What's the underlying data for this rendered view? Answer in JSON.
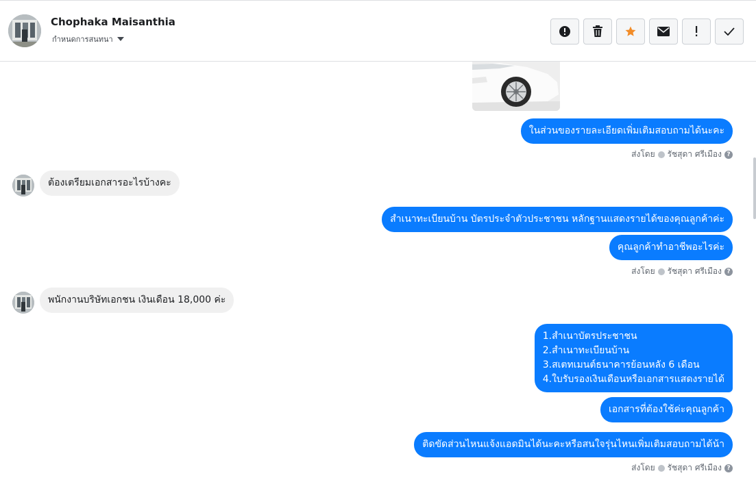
{
  "header": {
    "contact_name": "Chophaka Maisanthia",
    "subtitle": "กำหนดการสนทนา",
    "tools": [
      {
        "name": "report-spam-button",
        "icon": "alert-circle-icon"
      },
      {
        "name": "delete-button",
        "icon": "trash-icon"
      },
      {
        "name": "star-button",
        "icon": "star-icon"
      },
      {
        "name": "mark-unread-button",
        "icon": "envelope-icon"
      },
      {
        "name": "follow-up-button",
        "icon": "exclamation-icon"
      },
      {
        "name": "mark-done-button",
        "icon": "check-icon"
      }
    ],
    "star_color": "#f28c28"
  },
  "colors": {
    "outgoing": "#0a7cff",
    "incoming": "#f0f0f0"
  },
  "messages": {
    "m1": "ในส่วนของรายละเอียดเพิ่มเติมสอบถามได้นะคะ",
    "m2": "ต้องเตรียมเอกสารอะไรบ้างคะ",
    "m3": "สำเนาทะเบียนบ้าน บัตรประจำตัวประชาชน หลักฐานแสดงรายได้ของคุณลูกค้าค่ะ",
    "m4": "คุณลูกค้าทำอาชีพอะไรค่ะ",
    "m5": "พนักงานบริษัทเอกชน เงินเดือน 18,000 ค่ะ",
    "m6_lines": [
      "1.สำเนาบัตรประชาชน",
      "2.สำเนาทะเบียนบ้าน",
      "3.สเตทเมนต์ธนาคารย้อนหลัง 6 เดือน",
      "4.ใบรับรองเงินเดือนหรือเอกสารแสดงรายได้"
    ],
    "m7": "เอกสารที่ต้องใช้ค่ะคุณลูกค้า",
    "m8": "ติดขัดส่วนไหนแจ้งแอดมินได้นะคะหรือสนใจรุ่นไหนเพิ่มเติมสอบถามได้น้า"
  },
  "sent_by": {
    "prefix": "ส่งโดย",
    "sender": "รัชสุดา ศรีเมือง",
    "help": "?"
  }
}
